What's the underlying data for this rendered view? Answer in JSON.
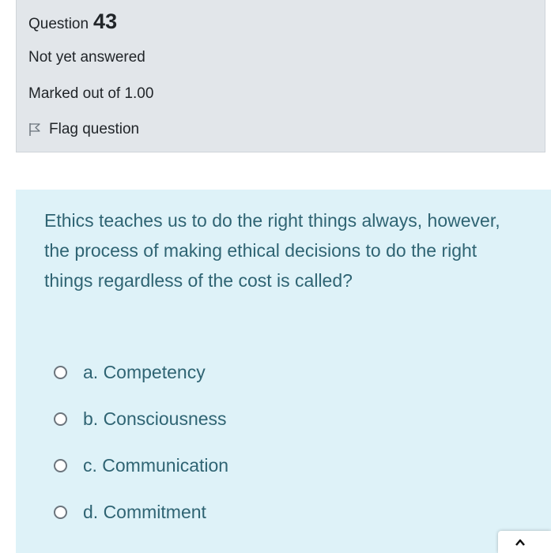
{
  "question_info": {
    "label": "Question",
    "number": "43",
    "state": "Not yet answered",
    "grade": "Marked out of 1.00",
    "flag_label": "Flag question"
  },
  "question": {
    "text": "Ethics teaches us to do the right things always, however, the process of making ethical decisions to do the right things regardless of the cost is called?",
    "answers": [
      {
        "label": "a. Competency",
        "selected": false
      },
      {
        "label": "b. Consciousness",
        "selected": false
      },
      {
        "label": "c. Communication",
        "selected": false
      },
      {
        "label": "d. Commitment",
        "selected": false
      }
    ]
  },
  "icons": {
    "flag": "flag-icon",
    "radio": "radio-icon",
    "corner": "chevron-up-icon"
  },
  "colors": {
    "info_background": "#e2e6ea",
    "content_background": "#def2f8",
    "content_text": "#2f6473"
  }
}
